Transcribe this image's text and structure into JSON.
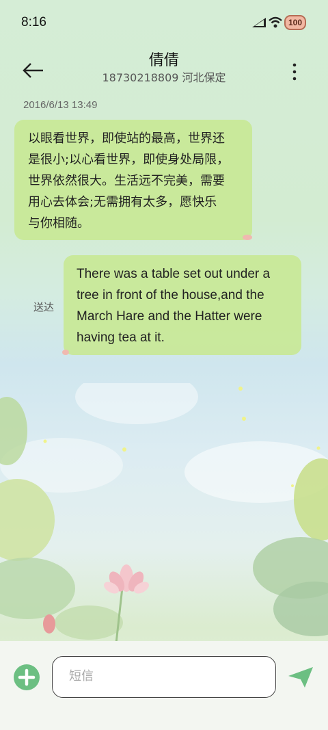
{
  "status_bar": {
    "time": "8:16",
    "battery": "100"
  },
  "header": {
    "contact_name": "倩倩",
    "contact_info": "18730218809 河北保定"
  },
  "conversation": {
    "timestamp": "2016/6/13 13:49",
    "messages": [
      {
        "direction": "incoming",
        "lines": [
          "以眼看世界，即使站的最高，世界还",
          "是很小;以心看世界，即使身处局限，",
          "世界依然很大。生活远不完美，需要",
          "用心去体会;无需拥有太多，愿快乐",
          "与你相随。"
        ]
      },
      {
        "direction": "outgoing",
        "status": "送达",
        "lines": [
          "There was a table set out under a",
          "tree in front of the house,and the",
          "March Hare and the Hatter were",
          "having tea at it."
        ]
      }
    ]
  },
  "composer": {
    "placeholder": "短信"
  },
  "colors": {
    "bubble": "#c8e896",
    "accent": "#6cbf82"
  }
}
